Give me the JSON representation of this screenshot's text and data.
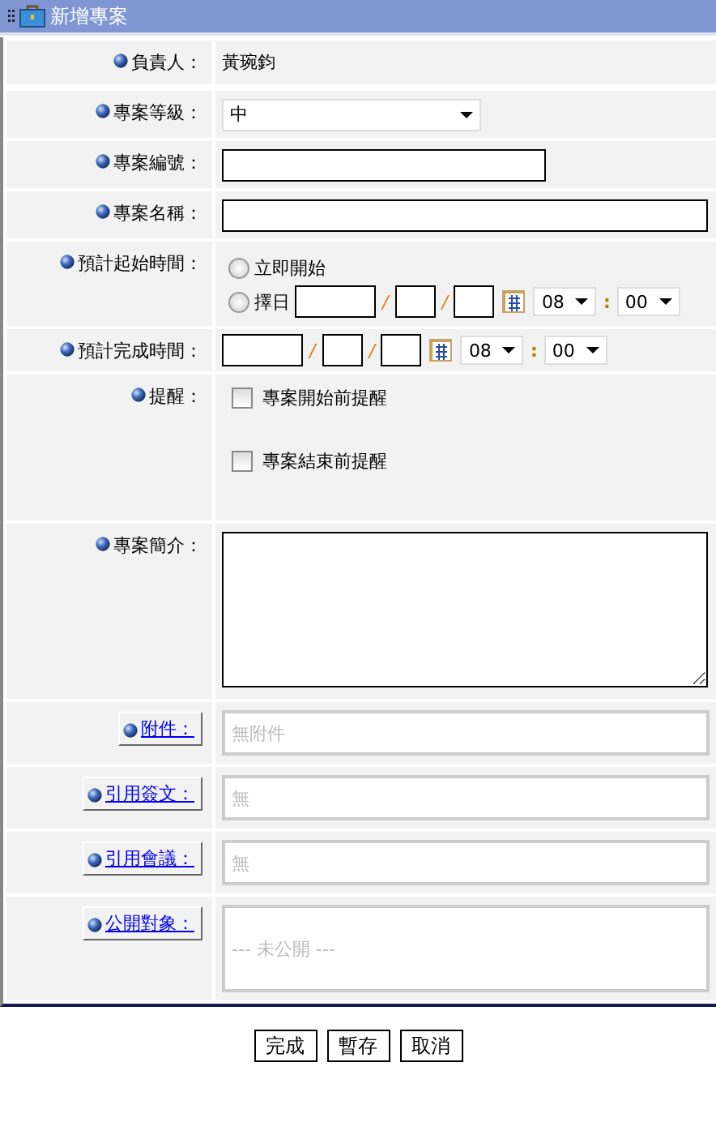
{
  "window": {
    "title": "新增專案"
  },
  "fields": [
    {
      "kind": "static",
      "label": "負責人：",
      "value": "黃琬鈞"
    },
    {
      "kind": "select",
      "label": "專案等級：",
      "value": "中"
    },
    {
      "kind": "short_input",
      "label": "專案編號："
    },
    {
      "kind": "long_input",
      "label": "專案名稱："
    },
    {
      "kind": "start_time",
      "label": "預計起始時間：",
      "options": [
        {
          "label": "立即開始",
          "selected": false
        },
        {
          "label": "擇日",
          "selected": false
        }
      ],
      "separators": [
        "/",
        "/"
      ],
      "hour": "08",
      "colon": ":",
      "minute": "00"
    },
    {
      "kind": "end_time",
      "label": "預計完成時間：",
      "separators": [
        "/",
        "/"
      ],
      "hour": "08",
      "colon": ":",
      "minute": "00"
    },
    {
      "kind": "checkboxes",
      "label": "提醒：",
      "items": [
        {
          "label": "專案開始前提醒",
          "checked": false
        },
        {
          "label": "專案結束前提醒",
          "checked": false
        }
      ]
    },
    {
      "kind": "textarea",
      "label": "專案簡介："
    },
    {
      "kind": "picker",
      "label": "附件：",
      "placeholder": "無附件"
    },
    {
      "kind": "picker",
      "label": "引用簽文：",
      "placeholder": "無"
    },
    {
      "kind": "picker",
      "label": "引用會議：",
      "placeholder": "無"
    },
    {
      "kind": "picker_tall",
      "label": "公開對象：",
      "placeholder": "--- 未公開 ---"
    }
  ],
  "buttons": [
    "完成",
    "暫存",
    "取消"
  ]
}
